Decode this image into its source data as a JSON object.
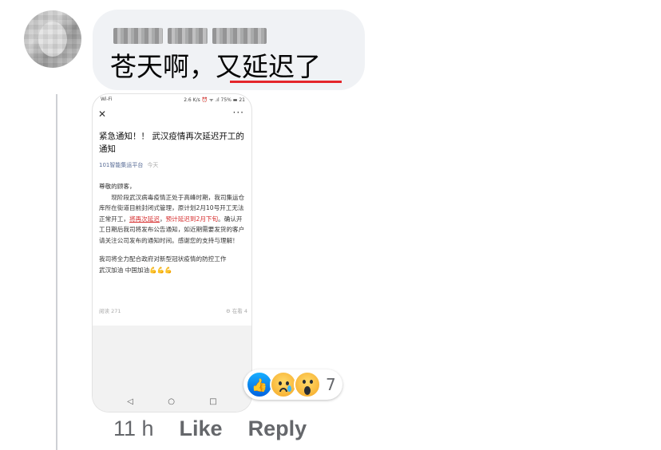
{
  "comment": {
    "text_plain": "苍天啊，",
    "text_underlined": "又延迟了",
    "underline_color": "#e4252a",
    "bubble_color": "#f0f2f5"
  },
  "attachment": {
    "statusbar": {
      "left": "Wi-Fi",
      "right": "2.6 K/s ⏰ ᯤ .ıl 75% ▬ 21"
    },
    "close_icon": "✕",
    "more_icon": "···",
    "title": "紧急通知！！ 武汉疫情再次延迟开工的通知",
    "source": "101智能集运平台",
    "date": "今天",
    "body": {
      "greeting": "尊敬的顾客，",
      "p1_a": "现阶段武汉病毒疫情正处于高峰时期，我司集运仓库所在街道目前封闭式管理，原计划2月10号开工无法正常开工，",
      "p1_red_underlined": "将再次延迟",
      "p1_comma": "，",
      "p1_red": "预计延迟到2月下旬",
      "p1_b": "。确认开工日期后我司将发布公告通知，如近期需要发货的客户请关注公司发布的通知时间。感谢您的支持与理解！",
      "p2": "我司将全力配合政府对新型冠状疫情的防控工作",
      "p3": "武汉加油  中国加油💪💪💪"
    },
    "reads": "阅读 271",
    "watching": "⚙ 在看 4",
    "nav": [
      "◁",
      "○",
      "□"
    ]
  },
  "reactions": {
    "like_icon": "👍",
    "count": "7"
  },
  "actions": {
    "time": "11 h",
    "like": "Like",
    "reply": "Reply"
  }
}
